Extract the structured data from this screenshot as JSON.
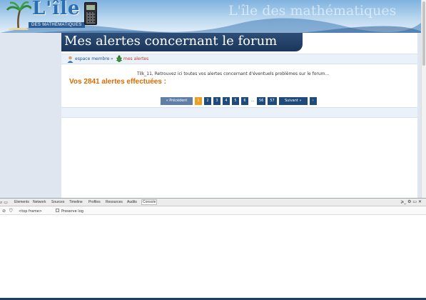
{
  "banner": {
    "logo_title": "L'île",
    "logo_subtitle": "DES MATHÉMATIQUES",
    "watermark": "L'île des mathématiques"
  },
  "page": {
    "title": "Mes alertes concernant le forum",
    "breadcrumb": {
      "link1": "espace membre",
      "separator": "»",
      "link2": "mes alertes"
    },
    "intro": "Tilk_11, Retrouvez ici toutes vos alertes concernant d'éventuels problèmes sur le forum...",
    "alert_count": "Vos 2841 alertes effectuées :",
    "pagination": {
      "prev": "« Précédent",
      "pages": [
        "1",
        "2",
        "3",
        "4",
        "5",
        "6"
      ],
      "active_page": "1",
      "ellipsis": "...",
      "page_56": "56",
      "page_57": "57",
      "next": "Suivant »",
      "last": "›"
    }
  },
  "devtools": {
    "tabs": [
      "Elements",
      "Network",
      "Sources",
      "Timeline",
      "Profiles",
      "Resources",
      "Audits",
      "Console"
    ],
    "active_tab": "Console",
    "frame_select": "<top frame>",
    "preserve_log": "Preserve log"
  },
  "colors": {
    "title_bg": "#1b355a",
    "accent_orange": "#d96b00",
    "page_button": "#1f4a7c",
    "active_page": "#f0a020"
  }
}
